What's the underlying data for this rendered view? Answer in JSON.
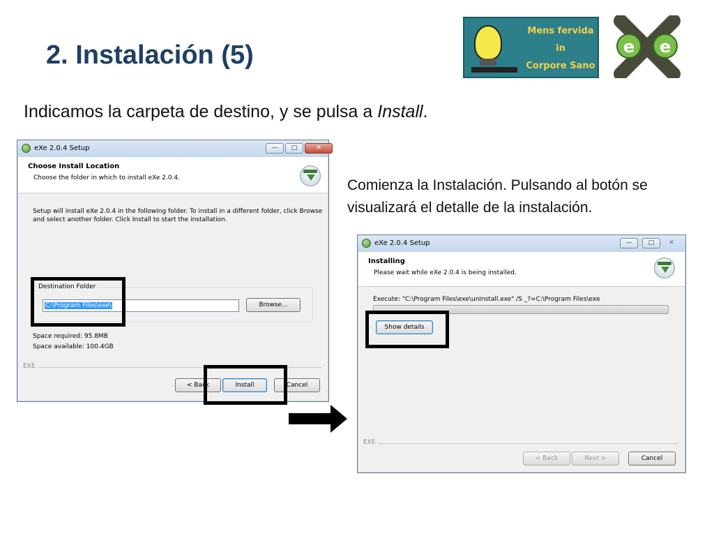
{
  "slide": {
    "title": "2. Instalación (5)",
    "subtitle_main": "Indicamos la carpeta de destino, y se pulsa a ",
    "subtitle_em": "Install",
    "subtitle_end": ".",
    "side_note": "Comienza la Instalación. Pulsando al botón se visualizará el detalle de la instalación."
  },
  "logos": {
    "banner_slogan": [
      "Mens fervida",
      "in",
      "Corpore Sano"
    ],
    "exe_letter": "e"
  },
  "dialog1": {
    "window_title": "eXe 2.0.4 Setup",
    "header_title": "Choose Install Location",
    "header_subtitle": "Choose the folder in which to install eXe 2.0.4.",
    "body_line1": "Setup will install eXe 2.0.4 in the following folder. To install in a different folder, click Browse",
    "body_line2": "and select another folder. Click Install to start the installation.",
    "group_label": "Destination Folder",
    "folder_value": "C:\\Program Files\\exe\\",
    "browse_label": "Browse...",
    "space_required": "Space required: 95.8MB",
    "space_available": "Space available: 100.4GB",
    "branding": "EXE",
    "back_label": "< Back",
    "install_label": "Install",
    "cancel_label": "Cancel"
  },
  "dialog2": {
    "window_title": "eXe 2.0.4 Setup",
    "header_title": "Installing",
    "header_subtitle": "Please wait while eXe 2.0.4 is being installed.",
    "execute_text": "Execute: \"C:\\Program Files\\exe\\uninstall.exe\" /S _?=C:\\Program Files\\exe",
    "show_details_label": "Show details",
    "branding": "EXE",
    "back_label": "< Back",
    "next_label": "Next >",
    "cancel_label": "Cancel"
  },
  "window_controls": {
    "minimize": "—",
    "maximize": "□",
    "close": "✕"
  },
  "colors": {
    "title": "#1f3f63",
    "highlight": "#000000",
    "selection": "#3399ff"
  }
}
